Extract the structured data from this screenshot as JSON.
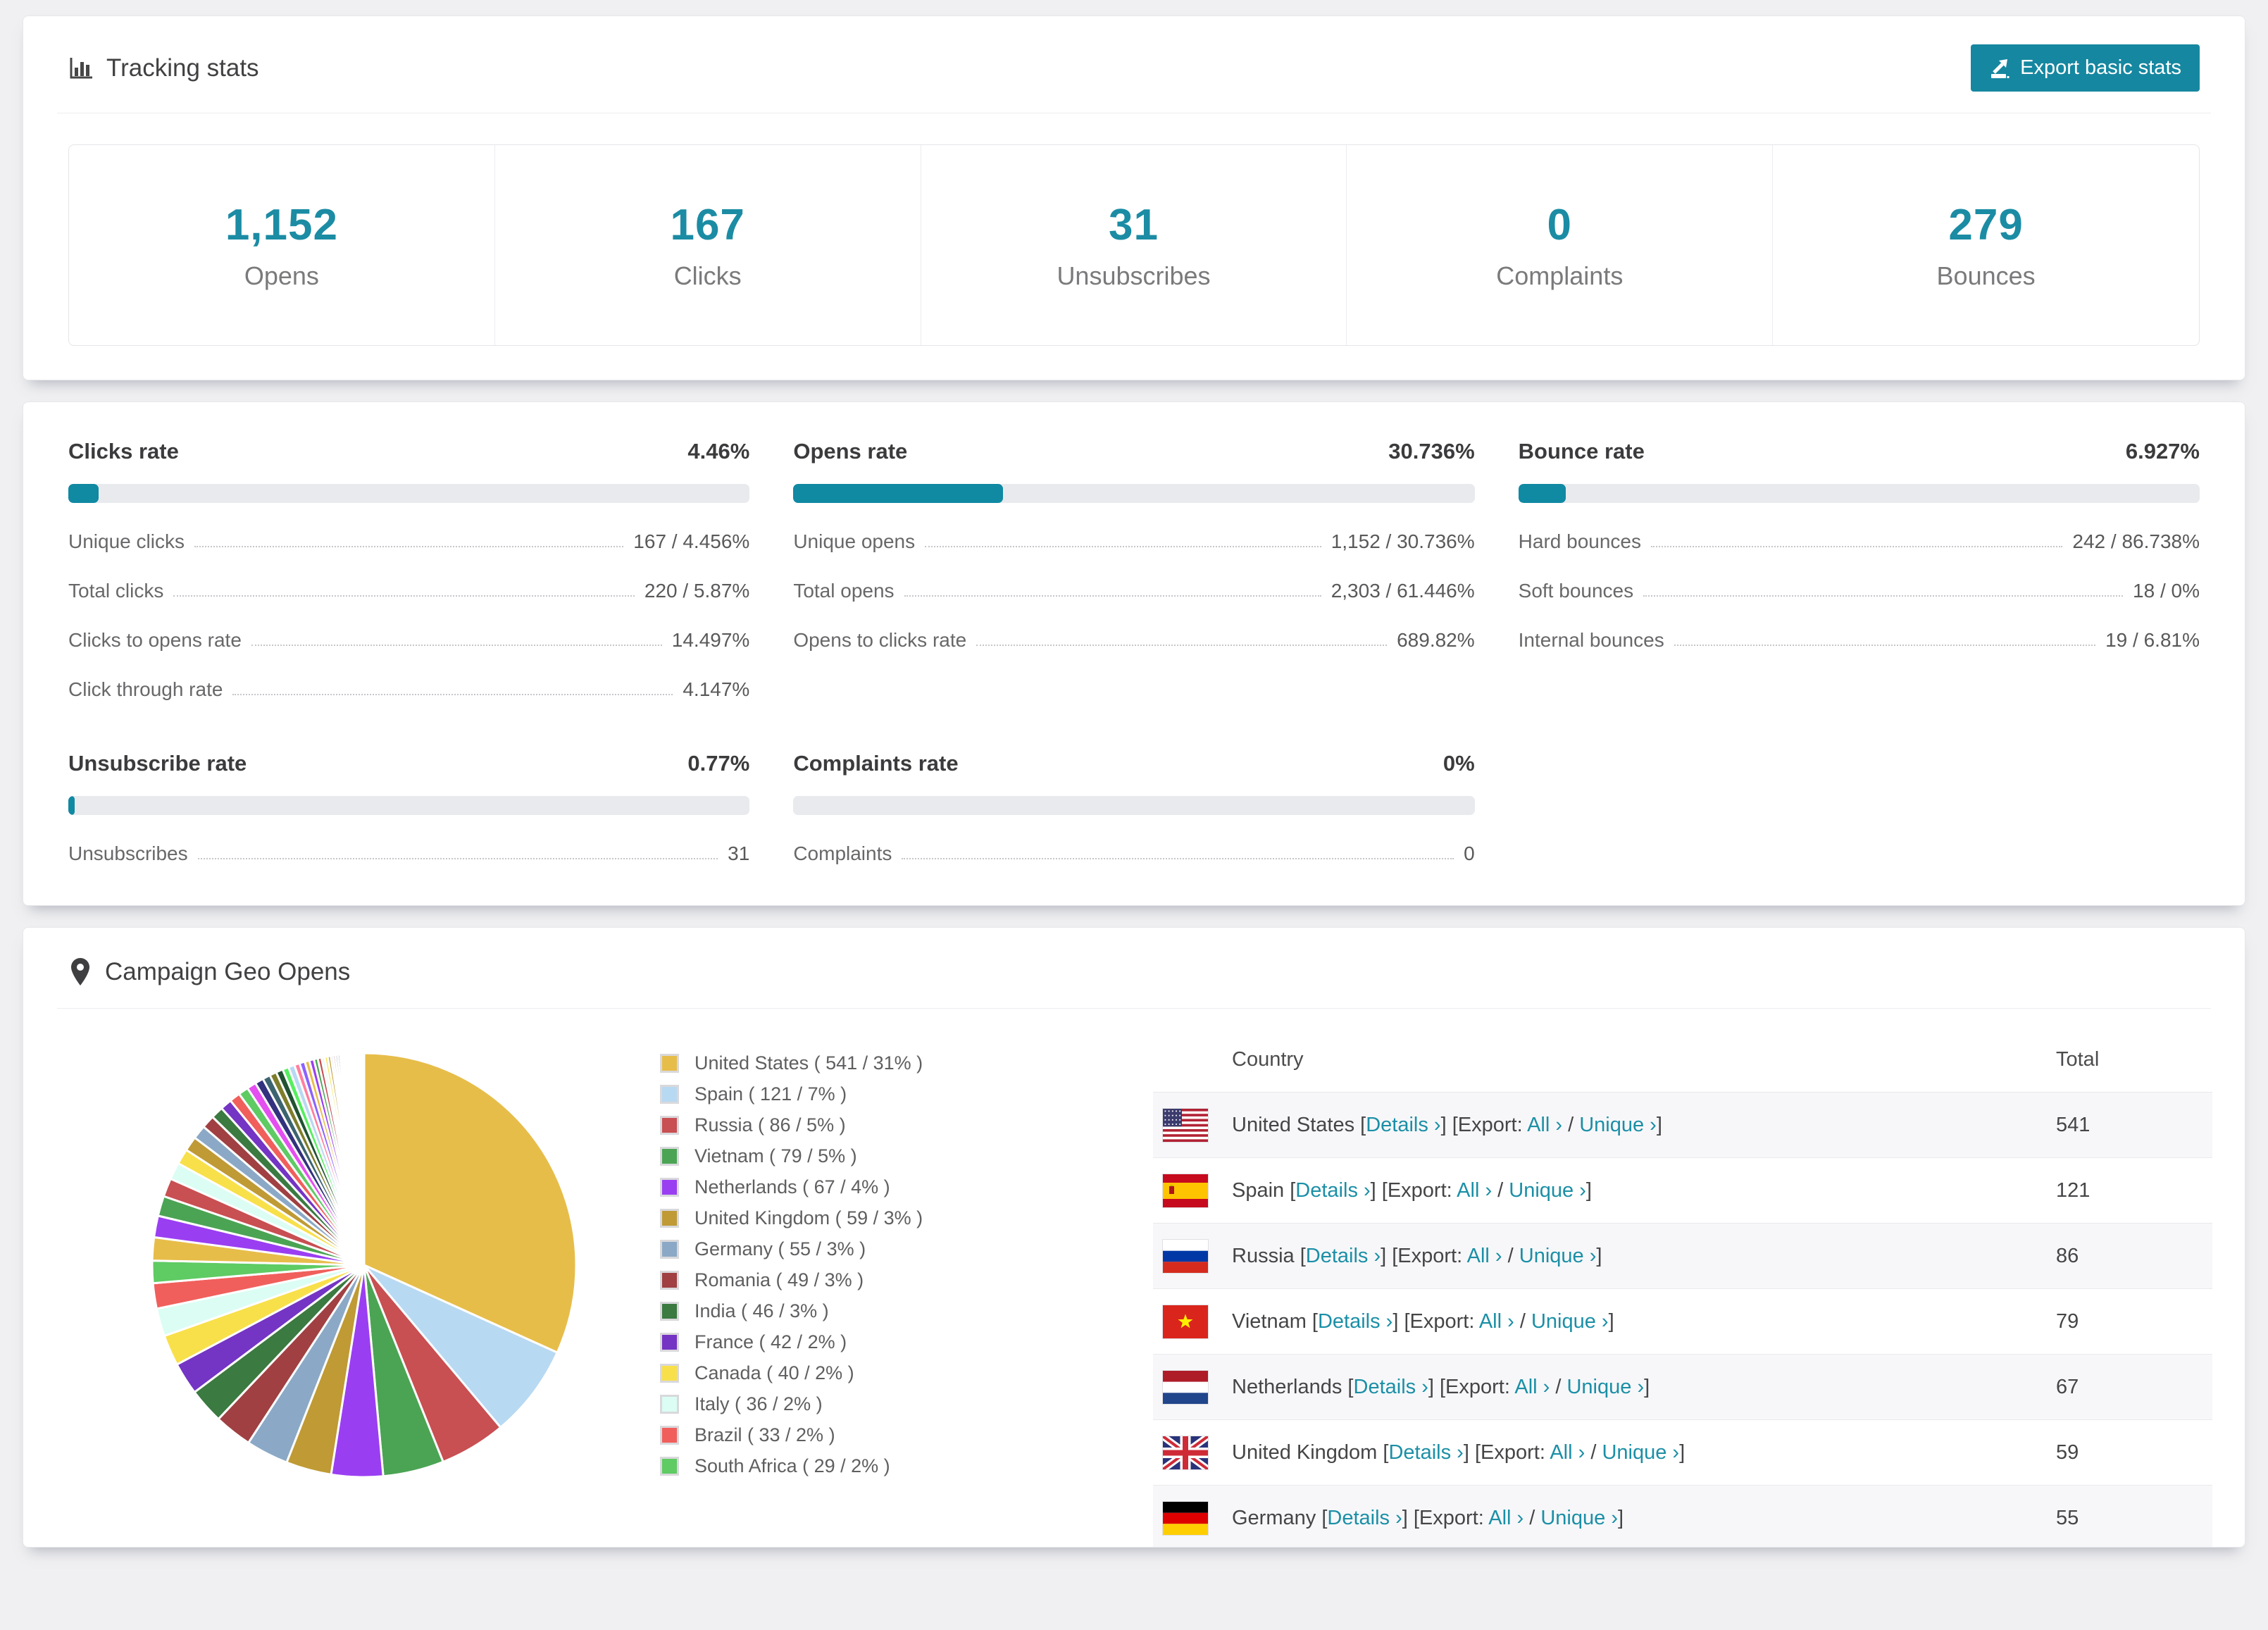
{
  "colors": {
    "accent": "#1b8ca4",
    "button_bg": "#1687a0",
    "bar_bg": "#e9eaee",
    "bar_fill": "#1089a3",
    "link": "#1b8fa6",
    "row_stripe": "#f7f7f9"
  },
  "header": {
    "title": "Tracking stats",
    "export_button": "Export basic stats"
  },
  "summary_stats": [
    {
      "value": "1,152",
      "label": "Opens"
    },
    {
      "value": "167",
      "label": "Clicks"
    },
    {
      "value": "31",
      "label": "Unsubscribes"
    },
    {
      "value": "0",
      "label": "Complaints"
    },
    {
      "value": "279",
      "label": "Bounces"
    }
  ],
  "rates": [
    {
      "title": "Clicks rate",
      "value": "4.46%",
      "percent": 4.46,
      "rows": [
        {
          "label": "Unique clicks",
          "value": "167 / 4.456%"
        },
        {
          "label": "Total clicks",
          "value": "220 / 5.87%"
        },
        {
          "label": "Clicks to opens rate",
          "value": "14.497%"
        },
        {
          "label": "Click through rate",
          "value": "4.147%"
        }
      ]
    },
    {
      "title": "Opens rate",
      "value": "30.736%",
      "percent": 30.736,
      "rows": [
        {
          "label": "Unique opens",
          "value": "1,152 / 30.736%"
        },
        {
          "label": "Total opens",
          "value": "2,303 / 61.446%"
        },
        {
          "label": "Opens to clicks rate",
          "value": "689.82%"
        }
      ]
    },
    {
      "title": "Bounce rate",
      "value": "6.927%",
      "percent": 6.927,
      "rows": [
        {
          "label": "Hard bounces",
          "value": "242 / 86.738%"
        },
        {
          "label": "Soft bounces",
          "value": "18 / 0%"
        },
        {
          "label": "Internal bounces",
          "value": "19 / 6.81%"
        }
      ]
    },
    {
      "title": "Unsubscribe rate",
      "value": "0.77%",
      "percent": 0.77,
      "rows": [
        {
          "label": "Unsubscribes",
          "value": "31"
        }
      ]
    },
    {
      "title": "Complaints rate",
      "value": "0%",
      "percent": 0,
      "rows": [
        {
          "label": "Complaints",
          "value": "0"
        }
      ]
    }
  ],
  "geo": {
    "title": "Campaign Geo Opens",
    "table": {
      "columns": [
        "Country",
        "Total"
      ],
      "link_labels": {
        "details": "Details ›",
        "export_prefix": "Export:",
        "all": "All ›",
        "unique": "Unique ›"
      },
      "rows": [
        {
          "country": "United States",
          "flag": "us",
          "total": "541"
        },
        {
          "country": "Spain",
          "flag": "es",
          "total": "121"
        },
        {
          "country": "Russia",
          "flag": "ru",
          "total": "86"
        },
        {
          "country": "Vietnam",
          "flag": "vn",
          "total": "79"
        },
        {
          "country": "Netherlands",
          "flag": "nl",
          "total": "67"
        },
        {
          "country": "United Kingdom",
          "flag": "gb",
          "total": "59"
        },
        {
          "country": "Germany",
          "flag": "de",
          "total": "55"
        }
      ]
    }
  },
  "chart_data": {
    "type": "pie",
    "title": "Campaign Geo Opens",
    "legend_position": "right",
    "labels": [
      "United States",
      "Spain",
      "Russia",
      "Vietnam",
      "Netherlands",
      "United Kingdom",
      "Germany",
      "Romania",
      "India",
      "France",
      "Canada",
      "Italy",
      "Brazil",
      "South Africa"
    ],
    "values": [
      541,
      121,
      86,
      79,
      67,
      59,
      55,
      49,
      46,
      42,
      40,
      36,
      33,
      29
    ],
    "percent_labels": [
      "31%",
      "7%",
      "5%",
      "5%",
      "4%",
      "3%",
      "3%",
      "3%",
      "3%",
      "2%",
      "2%",
      "2%",
      "2%",
      "2%"
    ],
    "colors": [
      "#e7bd4a",
      "#b8d9f2",
      "#c84f52",
      "#4ba454",
      "#9a3ef2",
      "#bf9a35",
      "#8ba9c6",
      "#a04042",
      "#3b7a40",
      "#7434c4",
      "#f8e04b",
      "#dbfdf4",
      "#f05f5c",
      "#5ecb63"
    ],
    "others_values": [
      30,
      28,
      26,
      24,
      22,
      20,
      19,
      18,
      17,
      16,
      15,
      14,
      13,
      12,
      11,
      10,
      9,
      9,
      8,
      8,
      7,
      7,
      6,
      6,
      5,
      5,
      4,
      4,
      4,
      3,
      3,
      3,
      3,
      2,
      2,
      2,
      2,
      2,
      2,
      2,
      2,
      1,
      1,
      1,
      1,
      1,
      1,
      1,
      1,
      1,
      1,
      1,
      1,
      1,
      1,
      1
    ],
    "others_color_cycle": [
      "#e7bd4a",
      "#9a3ef2",
      "#4ba454",
      "#c84f52",
      "#dbfdf4",
      "#f8e04b",
      "#bf9a35",
      "#8ba9c6",
      "#a04042",
      "#3b7a40",
      "#7434c4",
      "#f05f5c",
      "#5ecb63",
      "#e44ff0",
      "#32327e",
      "#3c6470",
      "#7d7d2b",
      "#215231",
      "#55ef5f",
      "#b8d9f2",
      "#ff7f9e",
      "#8c62ff"
    ]
  }
}
